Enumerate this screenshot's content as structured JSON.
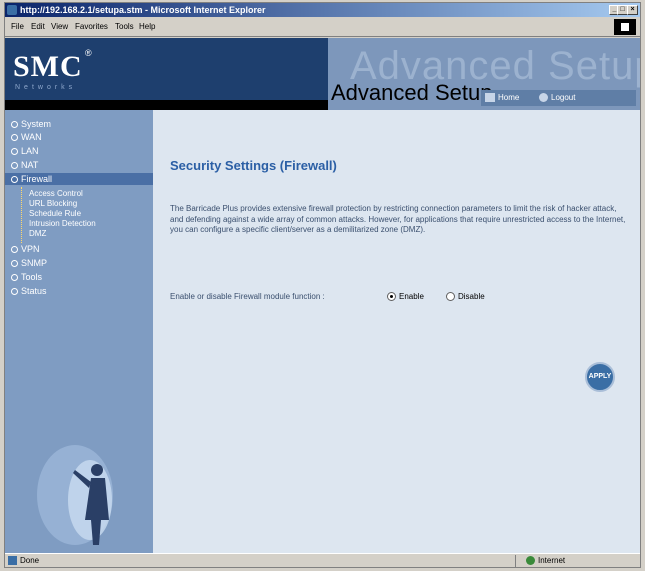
{
  "window": {
    "title": "http://192.168.2.1/setupa.stm - Microsoft Internet Explorer"
  },
  "menu": [
    "File",
    "Edit",
    "View",
    "Favorites",
    "Tools",
    "Help"
  ],
  "header": {
    "logo": "SMC",
    "logo_reg": "®",
    "logo_sub": "Networks",
    "banner_ghost": "Advanced Setup",
    "banner": "Advanced Setup",
    "home": "Home",
    "logout": "Logout"
  },
  "sidebar": {
    "items": [
      {
        "label": "System"
      },
      {
        "label": "WAN"
      },
      {
        "label": "LAN"
      },
      {
        "label": "NAT"
      },
      {
        "label": "Firewall"
      },
      {
        "label": "VPN"
      },
      {
        "label": "SNMP"
      },
      {
        "label": "Tools"
      },
      {
        "label": "Status"
      }
    ],
    "firewall_sub": [
      {
        "label": "Access Control"
      },
      {
        "label": "URL Blocking"
      },
      {
        "label": "Schedule Rule"
      },
      {
        "label": "Intrusion Detection"
      },
      {
        "label": "DMZ"
      }
    ]
  },
  "content": {
    "title": "Security Settings (Firewall)",
    "description": "The Barricade Plus provides extensive firewall protection by restricting connection parameters to limit the risk of hacker attack, and defending against a wide array of common attacks. However, for applications that require unrestricted access to the Internet, you can configure a specific client/server as a demilitarized zone (DMZ).",
    "firewall_label": "Enable or disable Firewall module function :",
    "enable_label": "Enable",
    "disable_label": "Disable",
    "selected": "Enable",
    "apply_label": "APPLY"
  },
  "statusbar": {
    "status": "Done",
    "zone": "Internet"
  },
  "colors": {
    "page_title": "#2b5fa5",
    "sidebar_bg": "#7f9cc2",
    "sidebar_active": "#4a6fa5",
    "header_bg": "#1e3f6e"
  }
}
